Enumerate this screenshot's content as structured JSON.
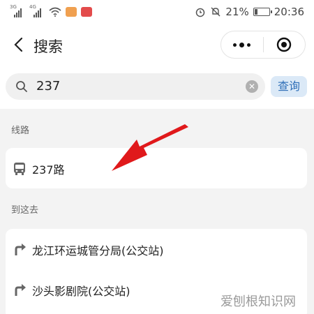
{
  "status_bar": {
    "signal1_tag": "3G",
    "signal2_tag": "4G",
    "battery_percent": "21%",
    "battery_level": 0.21,
    "time": "20:36"
  },
  "header": {
    "title": "搜索"
  },
  "search": {
    "value": "237",
    "query_label": "查询"
  },
  "sections": {
    "routes_label": "线路",
    "destinations_label": "到这去"
  },
  "routes": [
    {
      "label": "237路"
    }
  ],
  "destinations": [
    {
      "label": "龙江环运城管分局(公交站)"
    },
    {
      "label": "沙头影剧院(公交站)"
    }
  ],
  "watermark": "爱刨根知识网",
  "colors": {
    "accent_blue": "#2f6fb8",
    "query_bg": "#dbe9f7",
    "annotation_arrow": "#e0191b"
  },
  "icons": {
    "back": "chevron-left-icon",
    "more": "more-dots-icon",
    "close_target": "target-circle-icon",
    "search": "search-icon",
    "clear": "clear-icon",
    "bus": "bus-icon",
    "turn": "turn-right-arrow-icon"
  }
}
